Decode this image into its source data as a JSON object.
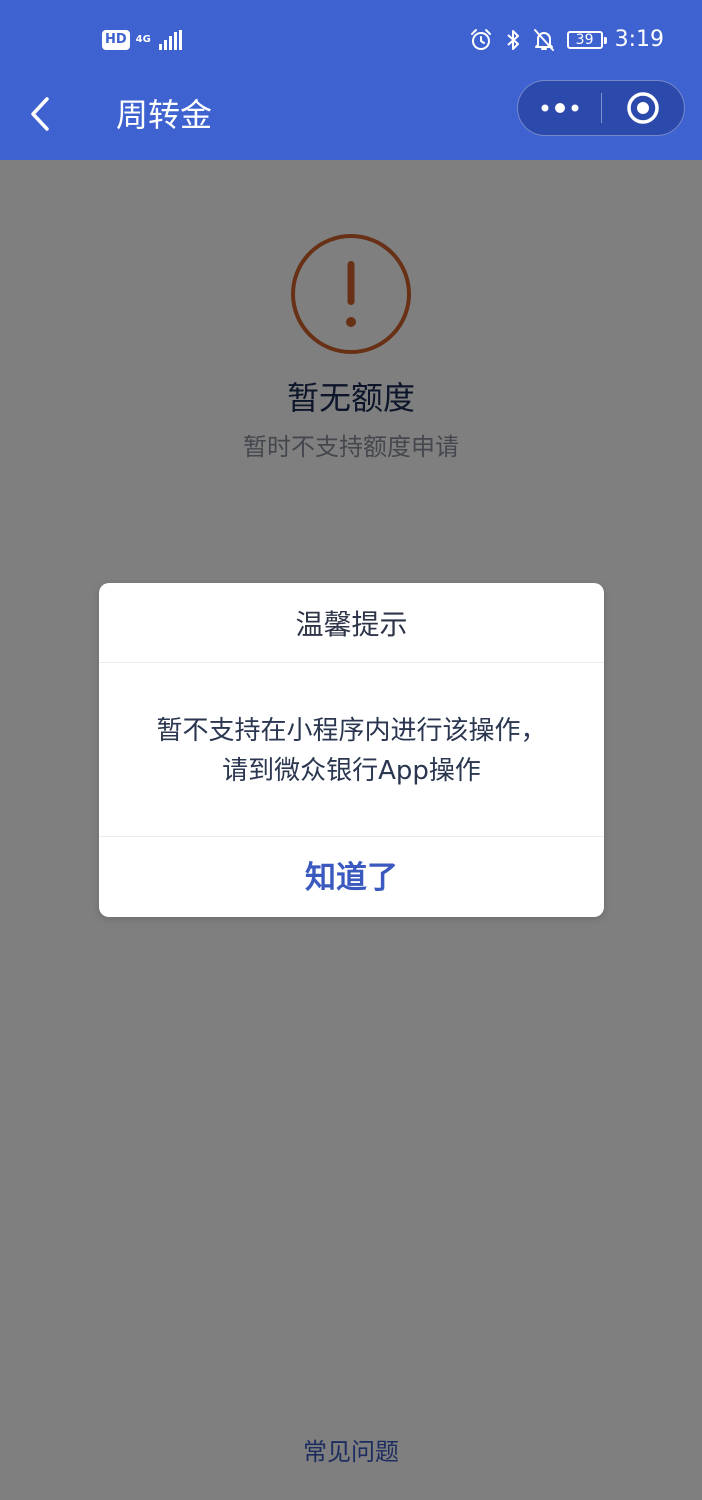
{
  "status_bar": {
    "hd_label": "HD",
    "network_type": "4G",
    "battery_level": "39",
    "time": "3:19",
    "icons": [
      "alarm-icon",
      "bluetooth-icon",
      "mute-icon"
    ]
  },
  "nav": {
    "title": "周转金",
    "back_icon": "back-arrow-icon",
    "more_icon": "more-dots-icon",
    "close_icon": "close-miniprogram-icon"
  },
  "empty_state": {
    "icon": "warning-icon",
    "title": "暂无额度",
    "subtitle": "暂时不支持额度申请"
  },
  "footer": {
    "faq_label": "常见问题"
  },
  "dialog": {
    "title": "温馨提示",
    "message_line1": "暂不支持在小程序内进行该操作，",
    "message_line2": "请到微众银行App操作",
    "confirm_label": "知道了"
  },
  "colors": {
    "header_bg": "#3e63d1",
    "accent": "#3a5abf",
    "warning": "#d0622d",
    "mask": "rgba(0,0,0,0.5)"
  }
}
